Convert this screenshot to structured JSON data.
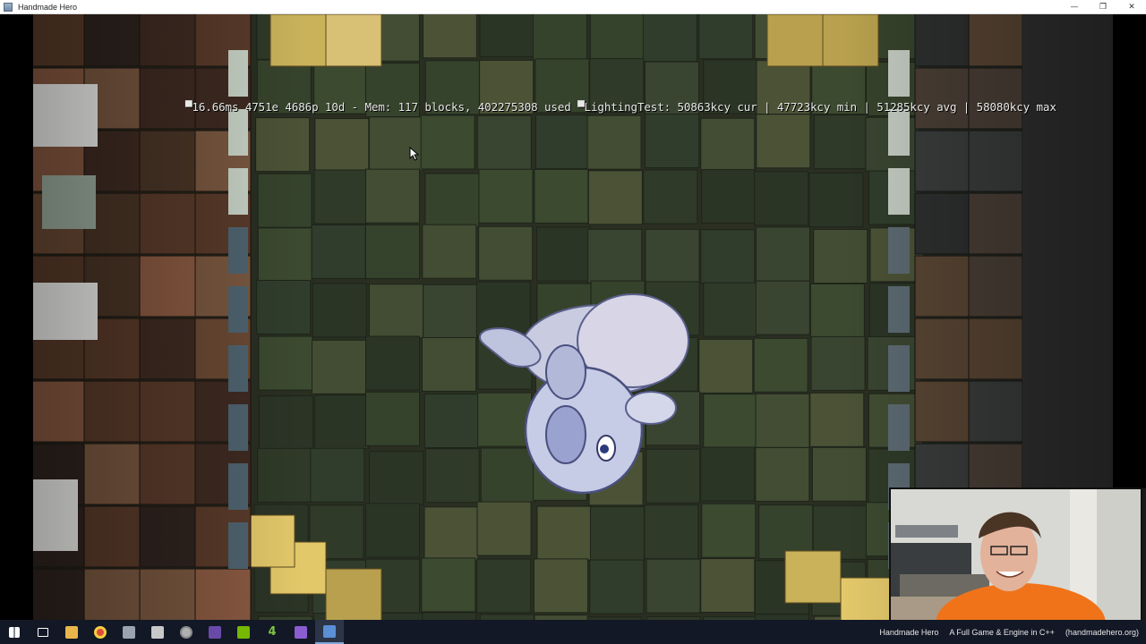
{
  "window": {
    "title": "Handmade Hero",
    "icon": "window-app-icon",
    "controls": {
      "minimize": "—",
      "restore": "❐",
      "close": "✕"
    }
  },
  "game": {
    "debug_overlay": "▀16.66ms 4751e 4686p 10d - Mem: 117 blocks, 402275308 used ▀LightingTest: 50863kcy cur | 47723kcy min | 51285kcy avg | 58080kcy max",
    "cursor_icon": "mouse-pointer-icon",
    "character_icon": "grey-creature-sprite"
  },
  "stream_caption": {
    "show": "Handmade Hero",
    "tagline": "A Full Game & Engine in C++",
    "site": "(handmadehero.org)"
  },
  "taskbar": {
    "items": [
      {
        "icon": "windows-start-icon",
        "color": "#ffffff"
      },
      {
        "icon": "task-view-icon",
        "color": "#ffffff"
      },
      {
        "icon": "file-explorer-icon",
        "color": "#e8b64a"
      },
      {
        "icon": "chrome-icon",
        "color": "#e04a3a"
      },
      {
        "icon": "terminal-icon",
        "color": "#9aa3b0"
      },
      {
        "icon": "person-icon",
        "color": "#c8c8c8"
      },
      {
        "icon": "globe-icon",
        "color": "#b0b0b0"
      },
      {
        "icon": "purple-app-icon",
        "color": "#6a4aa8"
      },
      {
        "icon": "nvidia-icon",
        "color": "#76b900"
      },
      {
        "icon": "app-4-icon",
        "color": "#7fc241",
        "label": "4"
      },
      {
        "icon": "visual-studio-icon",
        "color": "#8a5dd0"
      },
      {
        "icon": "handmade-window-icon",
        "color": "#5b8fd6",
        "active": true
      }
    ]
  }
}
